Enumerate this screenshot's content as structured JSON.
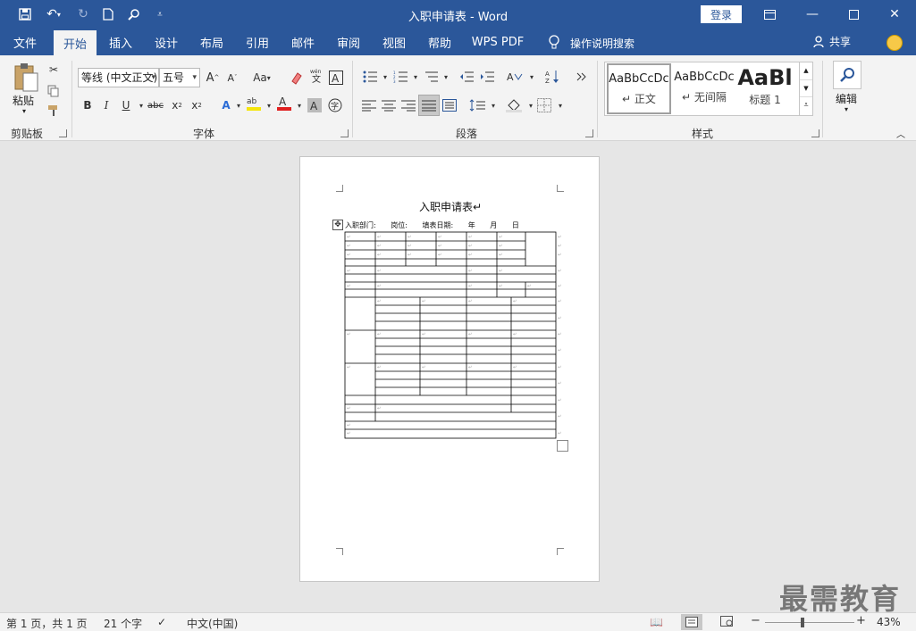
{
  "window": {
    "title": "入职申请表 - Word",
    "login_label": "登录"
  },
  "menu": {
    "tabs": [
      "文件",
      "开始",
      "插入",
      "设计",
      "布局",
      "引用",
      "邮件",
      "审阅",
      "视图",
      "帮助",
      "WPS PDF"
    ],
    "active_tab": "开始",
    "search_label": "操作说明搜索",
    "share_label": "共享"
  },
  "ribbon": {
    "clipboard": {
      "label": "剪贴板",
      "paste_label": "粘贴"
    },
    "font": {
      "label": "字体",
      "font_name": "等线 (中文正文)",
      "font_size": "五号",
      "case_label": "Aa"
    },
    "paragraph": {
      "label": "段落"
    },
    "styles": {
      "label": "样式",
      "items": [
        {
          "sample": "AaBbCcDc",
          "name": "正文"
        },
        {
          "sample": "AaBbCcDc",
          "name": "无间隔"
        },
        {
          "sample": "AaBl",
          "name": "标题 1"
        }
      ]
    },
    "editing": {
      "label": "编辑"
    }
  },
  "document": {
    "title": "入职申请表",
    "meta": [
      "入职部门:",
      "岗位:",
      "填表日期:",
      "年",
      "月",
      "日"
    ]
  },
  "statusbar": {
    "page": "第 1 页，共 1 页",
    "words": "21 个字",
    "language": "中文(中国)",
    "zoom": "43%"
  },
  "watermark": "最需教育",
  "colors": {
    "accent": "#2b579a",
    "font_color": "#e02020",
    "highlight": "#f5e50b"
  }
}
